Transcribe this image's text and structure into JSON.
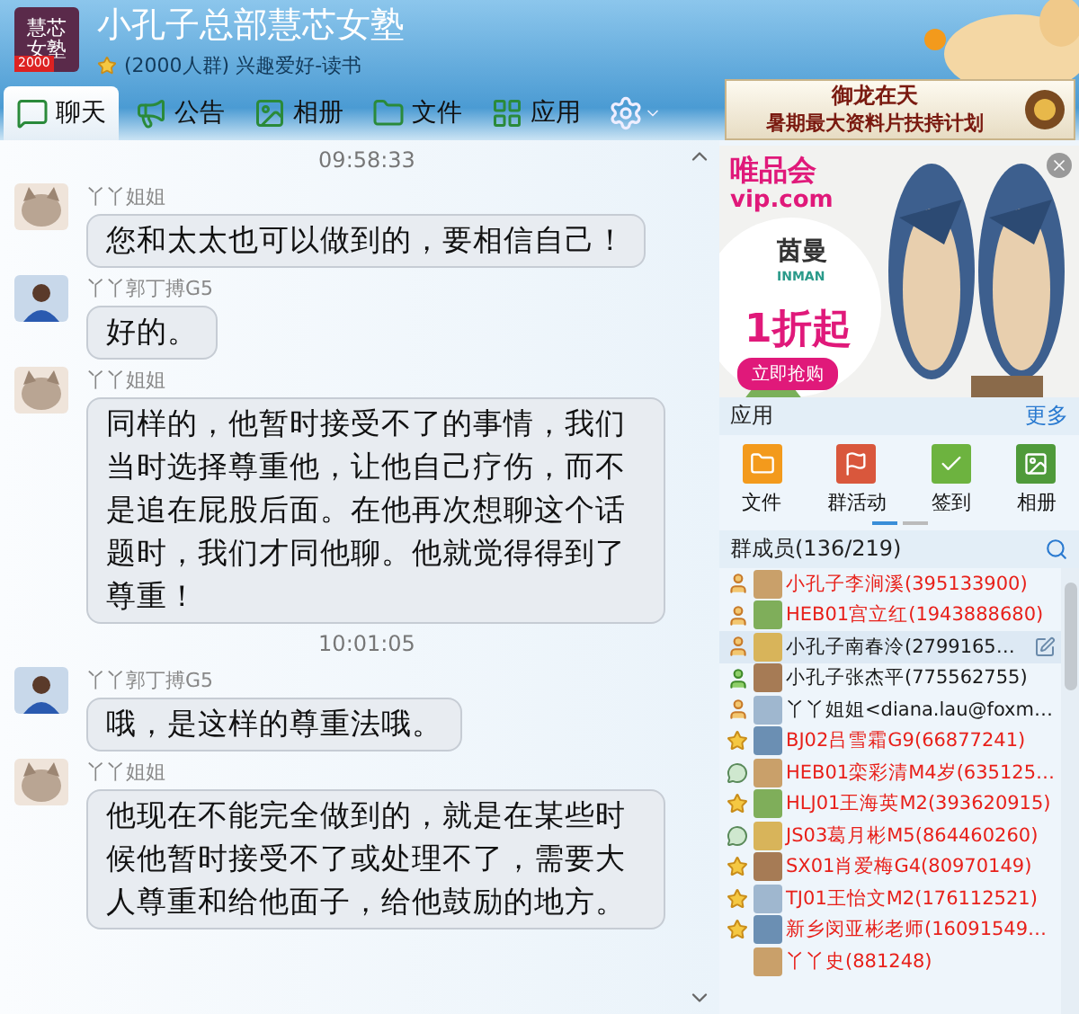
{
  "header": {
    "logo_text": "慧芯女塾",
    "logo_badge": "2000",
    "title": "小孔子总部慧芯女塾",
    "subtitle": "(2000人群) 兴趣爱好-读书"
  },
  "tabs": [
    {
      "label": "聊天",
      "kind": "chat",
      "selected": true
    },
    {
      "label": "公告",
      "kind": "notice",
      "selected": false
    },
    {
      "label": "相册",
      "kind": "album",
      "selected": false
    },
    {
      "label": "文件",
      "kind": "file",
      "selected": false
    },
    {
      "label": "应用",
      "kind": "apps",
      "selected": false
    }
  ],
  "banner_ad": {
    "line_1": "御龙在天",
    "line_2": "暑期最大资料片扶持计划"
  },
  "chat": [
    {
      "kind": "time",
      "text": "09:58:33"
    },
    {
      "kind": "message",
      "sender": "丫丫姐姐",
      "avatar": {
        "kind": "cat"
      },
      "text": "您和太太也可以做到的，要相信自己！"
    },
    {
      "kind": "message",
      "sender": "丫丫郭丁搏G5",
      "avatar": {
        "kind": "person"
      },
      "text": "好的。"
    },
    {
      "kind": "message",
      "sender": "丫丫姐姐",
      "avatar": {
        "kind": "cat"
      },
      "text": "同样的，他暂时接受不了的事情，我们当时选择尊重他，让他自己疗伤，而不是追在屁股后面。在他再次想聊这个话题时，我们才同他聊。他就觉得得到了尊重！"
    },
    {
      "kind": "time",
      "text": "10:01:05"
    },
    {
      "kind": "message",
      "sender": "丫丫郭丁搏G5",
      "avatar": {
        "kind": "person"
      },
      "text": "哦，是这样的尊重法哦。"
    },
    {
      "kind": "message",
      "sender": "丫丫姐姐",
      "avatar": {
        "kind": "cat"
      },
      "text": "他现在不能完全做到的，就是在某些时候他暂时接受不了或处理不了，需要大人尊重和给他面子，给他鼓励的地方。"
    }
  ],
  "side_ad": {
    "brand": "唯品会",
    "site": "vip.com",
    "maker": "茵曼",
    "maker_latin": "INMAN",
    "offer": "1折起",
    "cta": "立即抢购"
  },
  "apps": {
    "title": "应用",
    "more": "更多",
    "items": [
      {
        "label": "文件",
        "kind": "folder",
        "color": "#f39a1c"
      },
      {
        "label": "群活动",
        "kind": "flag",
        "color": "#d9573c"
      },
      {
        "label": "签到",
        "kind": "check",
        "color": "#6db33f"
      },
      {
        "label": "相册",
        "color": "#4f9a3a"
      }
    ]
  },
  "members": {
    "title": "群成员(136/219)",
    "rows": [
      {
        "name": "小孔子李涧溪(395133900)",
        "kind": "owner",
        "color": "#e8201a",
        "hovered": false
      },
      {
        "name": "HEB01宫立红(1943888680)",
        "kind": "owner",
        "color": "#e8201a",
        "hovered": false
      },
      {
        "name": "小孔子南春泠(2799165…",
        "kind": "owner",
        "color": "#1a1a1a",
        "hovered": true
      },
      {
        "name": "小孔子张杰平(775562755)",
        "kind": "member",
        "color": "#1a1a1a",
        "hovered": false
      },
      {
        "name": "丫丫姐姐<diana.lau@foxm…",
        "kind": "owner",
        "color": "#1a1a1a",
        "hovered": false
      },
      {
        "name": "BJ02吕雪霜G9(66877241)",
        "kind": "star",
        "color": "#e8201a",
        "hovered": false
      },
      {
        "name": "HEB01栾彩清M4岁(635125…",
        "kind": "chat",
        "color": "#e8201a",
        "hovered": false
      },
      {
        "name": "HLJ01王海英M2(393620915)",
        "kind": "star",
        "color": "#e8201a",
        "hovered": false
      },
      {
        "name": "JS03葛月彬M5(864460260)",
        "kind": "chat",
        "color": "#e8201a",
        "hovered": false
      },
      {
        "name": "SX01肖爱梅G4(80970149)",
        "kind": "star",
        "color": "#e8201a",
        "hovered": false
      },
      {
        "name": "TJ01王怡文M2(176112521)",
        "kind": "star",
        "color": "#e8201a",
        "hovered": false
      },
      {
        "name": "新乡闵亚彬老师(16091549…",
        "kind": "star",
        "color": "#e8201a",
        "hovered": false
      },
      {
        "name": "丫丫史(881248)",
        "kind": "plain",
        "color": "#e8201a",
        "hovered": false
      }
    ]
  }
}
